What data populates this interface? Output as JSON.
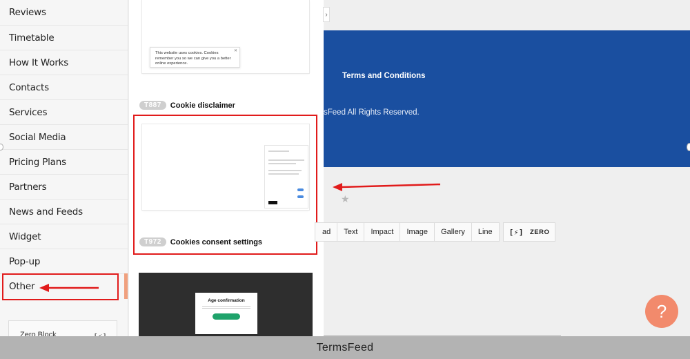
{
  "sidebar": {
    "items": [
      {
        "label": "Reviews"
      },
      {
        "label": "Timetable"
      },
      {
        "label": "How It Works"
      },
      {
        "label": "Contacts"
      },
      {
        "label": "Services"
      },
      {
        "label": "Social Media"
      },
      {
        "label": "Pricing Plans"
      },
      {
        "label": "Partners"
      },
      {
        "label": "News and Feeds"
      },
      {
        "label": "Widget"
      },
      {
        "label": "Pop-up"
      },
      {
        "label": "Other"
      }
    ],
    "active_item": "Other",
    "zero_card_label": "Zero Block"
  },
  "templates": [
    {
      "id": "T887",
      "name": "Cookie disclaimer",
      "preview_text": "This website uses cookies. Cookies remember you so we can give you a better online experience."
    },
    {
      "id": "T972",
      "name": "Cookies consent settings",
      "highlighted": true
    },
    {
      "preview_title": "Age confirmation"
    }
  ],
  "preview": {
    "banner_title": "Terms and Conditions",
    "banner_rights": "sFeed All Rights Reserved.",
    "banner_color": "#1a4fa0"
  },
  "toolbar": {
    "buttons": [
      "ad",
      "Text",
      "Impact",
      "Image",
      "Gallery",
      "Line"
    ],
    "zero_label": "ZERO"
  },
  "help_label": "?",
  "caption": "TermsFeed",
  "colors": {
    "highlight_red": "#e11b1b",
    "help_button": "#f28a6c",
    "accent_active": "#f0a07e"
  },
  "icons": {
    "collapse": "chevron-right-icon",
    "star": "star-icon",
    "zero": "zero-block-icon"
  }
}
